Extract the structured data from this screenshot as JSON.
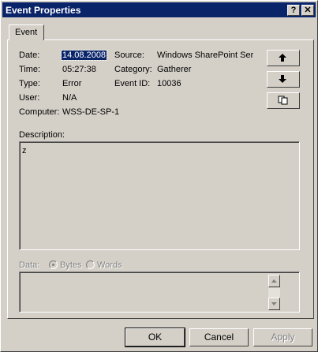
{
  "window": {
    "title": "Event Properties",
    "help_glyph": "?",
    "close_glyph": "✕"
  },
  "tabs": [
    {
      "label": "Event"
    }
  ],
  "event": {
    "date_label": "Date:",
    "date_value": "14.08.2008",
    "time_label": "Time:",
    "time_value": "05:27:38",
    "type_label": "Type:",
    "type_value": "Error",
    "user_label": "User:",
    "user_value": "N/A",
    "computer_label": "Computer:",
    "computer_value": "WSS-DE-SP-1",
    "source_label": "Source:",
    "source_value": "Windows SharePoint Ser",
    "category_label": "Category:",
    "category_value": "Gatherer",
    "eventid_label": "Event ID:",
    "eventid_value": "10036"
  },
  "nav": {
    "up_icon": "arrow-up-icon",
    "down_icon": "arrow-down-icon",
    "copy_icon": "copy-icon"
  },
  "description": {
    "label": "Description:",
    "text": "z"
  },
  "data_section": {
    "label": "Data:",
    "bytes_label": "Bytes",
    "words_label": "Words",
    "selected": "Bytes"
  },
  "buttons": {
    "ok": "OK",
    "cancel": "Cancel",
    "apply": "Apply"
  }
}
